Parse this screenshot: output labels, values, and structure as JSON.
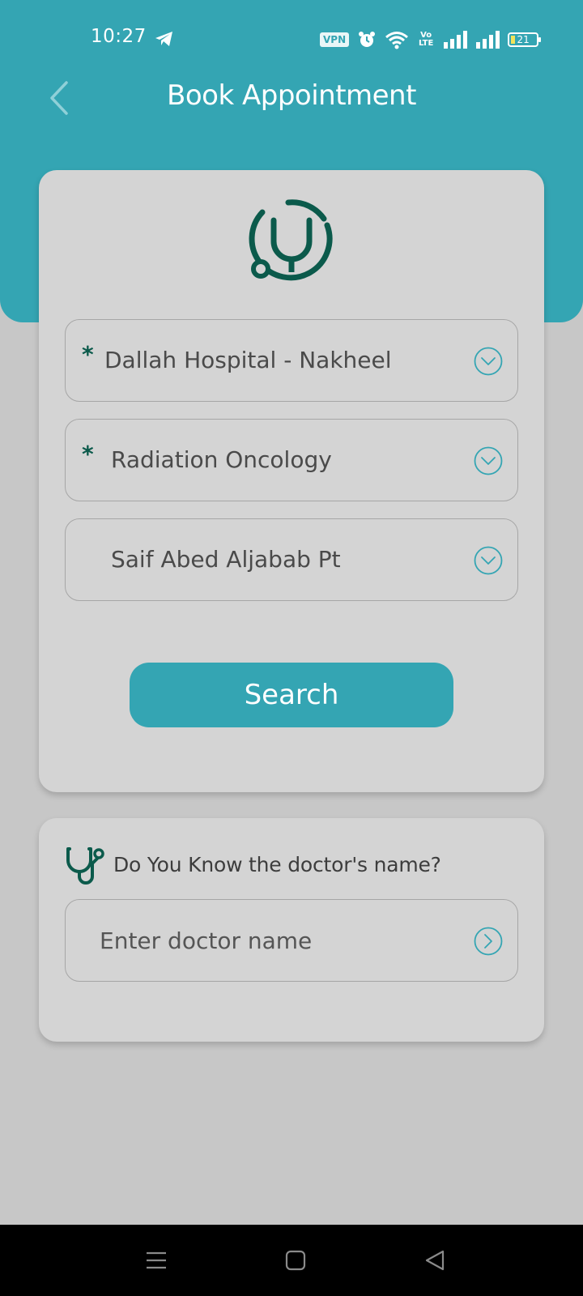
{
  "status_bar": {
    "time": "10:27",
    "vpn_label": "VPN",
    "volte_label": "Vo LTE",
    "battery_level": "21",
    "icons": [
      "telegram-icon",
      "vpn-icon",
      "alarm-icon",
      "wifi-icon",
      "signal-icon",
      "signal-icon",
      "battery-icon"
    ]
  },
  "header": {
    "title": "Book Appointment",
    "back_icon": "chevron-left-icon"
  },
  "form": {
    "logo_icon": "stethoscope-icon",
    "hospital": {
      "value": "Dallah Hospital - Nakheel",
      "required_mark": "*"
    },
    "specialty": {
      "value": "Radiation Oncology",
      "required_mark": "*"
    },
    "doctor": {
      "value": "Saif Abed Aljabab  Pt"
    },
    "search_label": "Search"
  },
  "doctor_search": {
    "question": "Do You Know the doctor's name?",
    "placeholder": "Enter doctor name",
    "go_icon": "chevron-right-circle-icon"
  },
  "nav_bar": {
    "icons": [
      "menu-icon",
      "home-icon",
      "back-icon"
    ]
  },
  "colors": {
    "accent": "#34a5b3",
    "icon_dark_green": "#0b5a4b",
    "card_bg": "#d4d4d4",
    "page_bg": "#c7c7c7"
  }
}
